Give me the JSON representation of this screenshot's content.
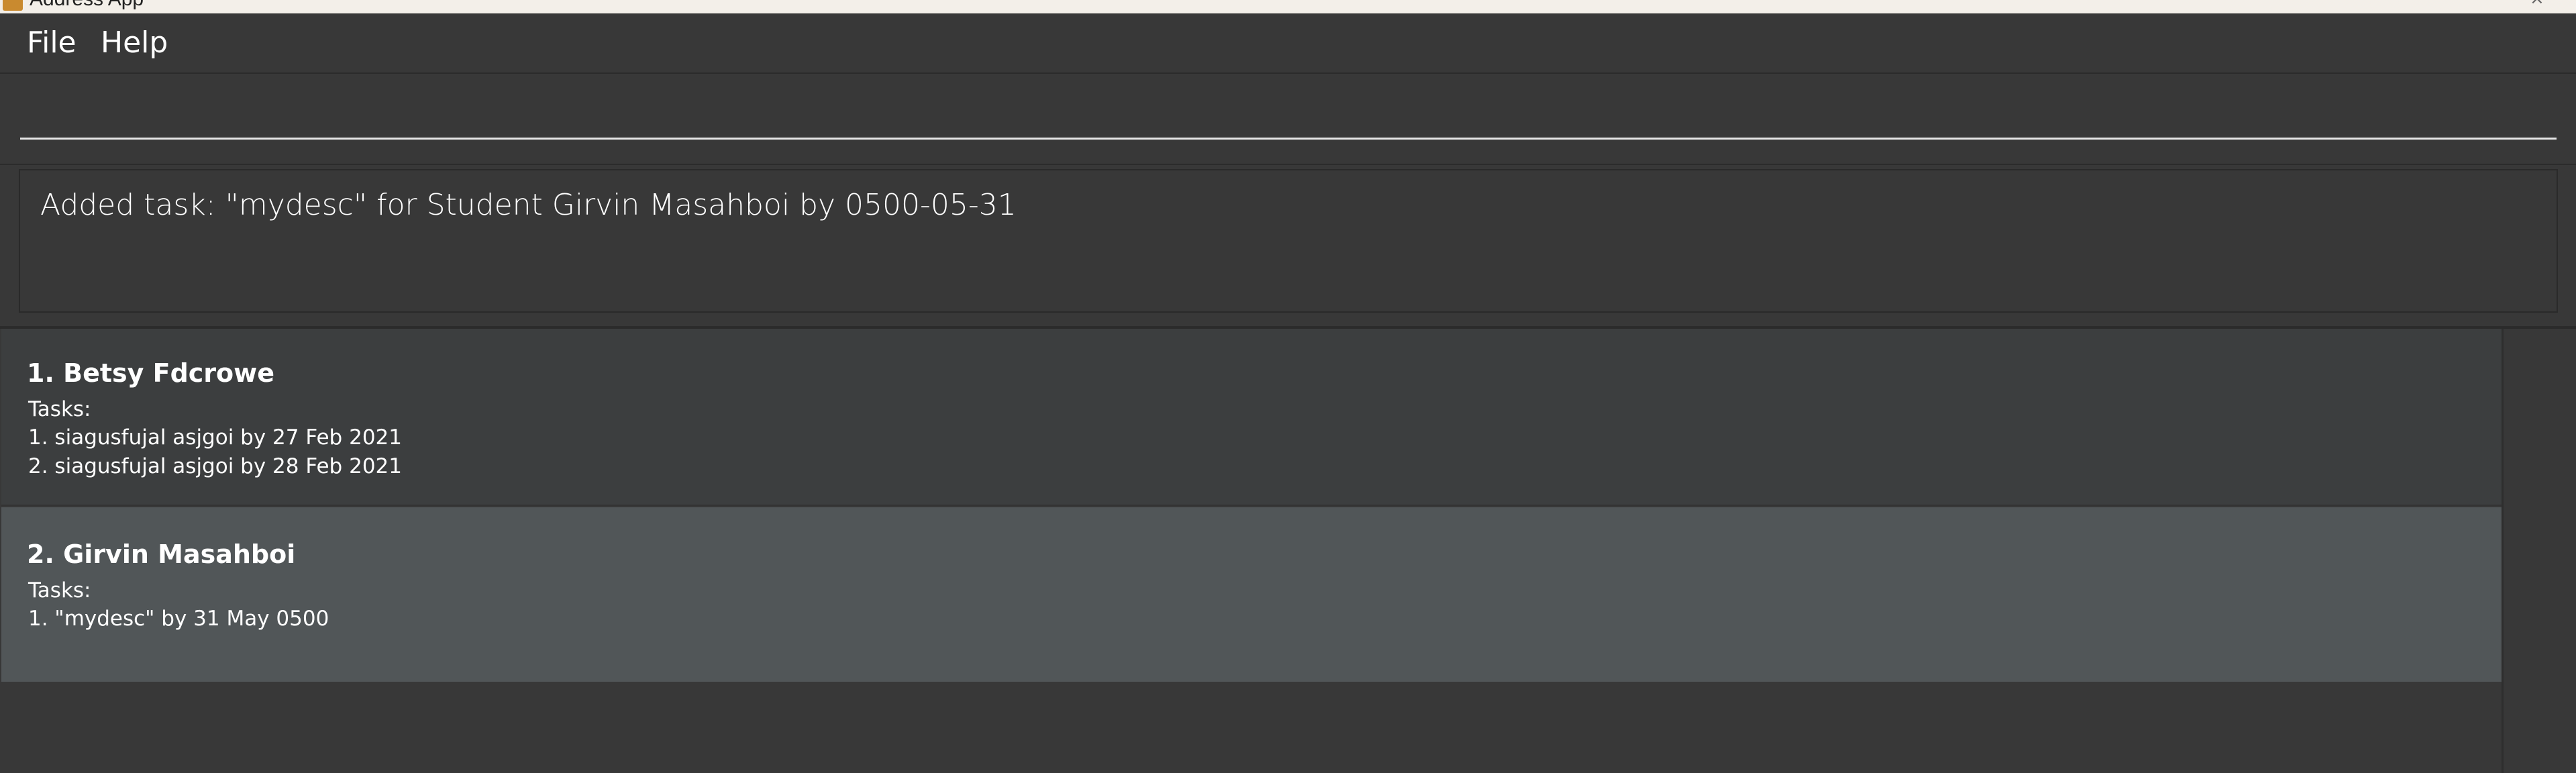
{
  "window": {
    "title": "Address App"
  },
  "menu": {
    "items": [
      {
        "label": "File"
      },
      {
        "label": "Help"
      }
    ]
  },
  "command": {
    "value": "",
    "placeholder": ""
  },
  "result": {
    "message": "Added task: \"mydesc\" for Student Girvin Masahboi by 0500-05-31"
  },
  "persons": [
    {
      "name": "1. Betsy Fdcrowe",
      "tasks_label": "Tasks:",
      "tasks": [
        "1. siagusfujal asjgoi by 27 Feb 2021",
        "2. siagusfujal asjgoi by 28 Feb 2021"
      ],
      "selected": false
    },
    {
      "name": "2. Girvin Masahboi",
      "tasks_label": "Tasks:",
      "tasks": [
        "1. \"mydesc\" by 31 May 0500"
      ],
      "selected": true
    }
  ],
  "colors": {
    "background": "#383838",
    "card": "#3c3e3f",
    "card_selected": "#515658",
    "text": "#ffffff"
  }
}
